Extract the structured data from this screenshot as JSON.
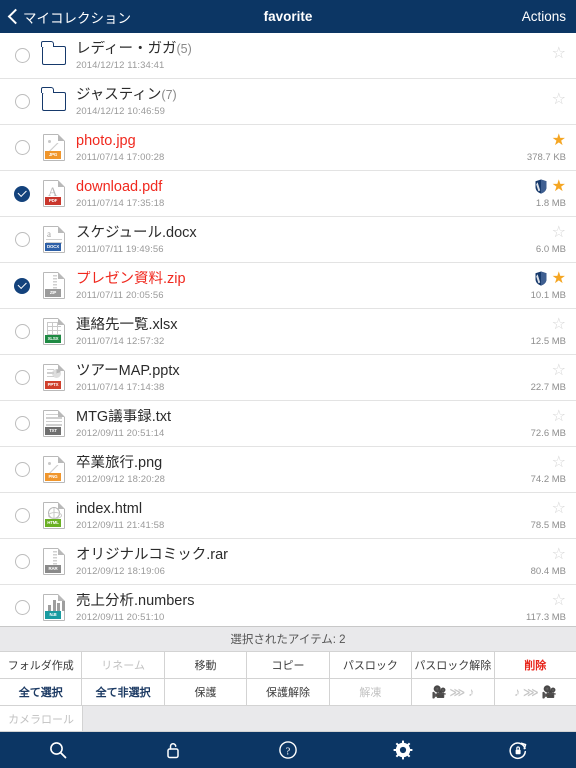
{
  "navbar": {
    "back_label": "マイコレクション",
    "title": "favorite",
    "actions_label": "Actions",
    "bg_color": "#0c3664"
  },
  "list": {
    "rows": [
      {
        "kind": "folder",
        "name": "レディー・ガガ",
        "count": "(5)",
        "date": "2014/12/12 11:34:41",
        "size": "",
        "checked": false,
        "starred": false,
        "locked": false,
        "name_red": false,
        "tag": ""
      },
      {
        "kind": "folder",
        "name": "ジャスティン",
        "count": "(7)",
        "date": "2014/12/12 10:46:59",
        "size": "",
        "checked": false,
        "starred": false,
        "locked": false,
        "name_red": false,
        "tag": ""
      },
      {
        "kind": "jpg",
        "name": "photo.jpg",
        "count": "",
        "date": "2011/07/14 17:00:28",
        "size": "378.7 KB",
        "checked": false,
        "starred": true,
        "locked": false,
        "name_red": true,
        "tag": "JPG"
      },
      {
        "kind": "pdf",
        "name": "download.pdf",
        "count": "",
        "date": "2011/07/14 17:35:18",
        "size": "1.8 MB",
        "checked": true,
        "starred": true,
        "locked": true,
        "name_red": true,
        "tag": "PDF"
      },
      {
        "kind": "docx",
        "name": "スケジュール.docx",
        "count": "",
        "date": "2011/07/11 19:49:56",
        "size": "6.0 MB",
        "checked": false,
        "starred": false,
        "locked": false,
        "name_red": false,
        "tag": "DOCX"
      },
      {
        "kind": "zip",
        "name": "プレゼン資料.zip",
        "count": "",
        "date": "2011/07/11 20:05:56",
        "size": "10.1 MB",
        "checked": true,
        "starred": true,
        "locked": true,
        "name_red": true,
        "tag": "ZIP"
      },
      {
        "kind": "xlsx",
        "name": "連絡先一覧.xlsx",
        "count": "",
        "date": "2011/07/14 12:57:32",
        "size": "12.5 MB",
        "checked": false,
        "starred": false,
        "locked": false,
        "name_red": false,
        "tag": "XLSX"
      },
      {
        "kind": "pptx",
        "name": "ツアーMAP.pptx",
        "count": "",
        "date": "2011/07/14 17:14:38",
        "size": "22.7 MB",
        "checked": false,
        "starred": false,
        "locked": false,
        "name_red": false,
        "tag": "PPTX"
      },
      {
        "kind": "txt",
        "name": "MTG議事録.txt",
        "count": "",
        "date": "2012/09/11 20:51:14",
        "size": "72.6 MB",
        "checked": false,
        "starred": false,
        "locked": false,
        "name_red": false,
        "tag": "TXT"
      },
      {
        "kind": "png",
        "name": "卒業旅行.png",
        "count": "",
        "date": "2012/09/12 18:20:28",
        "size": "74.2 MB",
        "checked": false,
        "starred": false,
        "locked": false,
        "name_red": false,
        "tag": "PNG"
      },
      {
        "kind": "html",
        "name": "index.html",
        "count": "",
        "date": "2012/09/11 21:41:58",
        "size": "78.5 MB",
        "checked": false,
        "starred": false,
        "locked": false,
        "name_red": false,
        "tag": "HTML"
      },
      {
        "kind": "rar",
        "name": "オリジナルコミック.rar",
        "count": "",
        "date": "2012/09/12 18:19:06",
        "size": "80.4 MB",
        "checked": false,
        "starred": false,
        "locked": false,
        "name_red": false,
        "tag": "RAR"
      },
      {
        "kind": "numbers",
        "name": "売上分析.numbers",
        "count": "",
        "date": "2012/09/11 20:51:10",
        "size": "117.3 MB",
        "checked": false,
        "starred": false,
        "locked": false,
        "name_red": false,
        "tag": "N.B"
      }
    ]
  },
  "panel": {
    "selected_text": "選択されたアイテム: 2",
    "row1": [
      {
        "label": "フォルダ作成",
        "state": "normal"
      },
      {
        "label": "リネーム",
        "state": "disabled"
      },
      {
        "label": "移動",
        "state": "normal"
      },
      {
        "label": "コピー",
        "state": "normal"
      },
      {
        "label": "パスロック",
        "state": "normal"
      },
      {
        "label": "パスロック解除",
        "state": "normal"
      },
      {
        "label": "削除",
        "state": "danger"
      }
    ],
    "row2": [
      {
        "label": "全て選択",
        "state": "bold"
      },
      {
        "label": "全て非選択",
        "state": "bold"
      },
      {
        "label": "保護",
        "state": "normal"
      },
      {
        "label": "保護解除",
        "state": "normal"
      },
      {
        "label": "解凍",
        "state": "disabled"
      },
      {
        "label": "",
        "state": "conv-video-to-audio"
      },
      {
        "label": "",
        "state": "conv-audio-to-video"
      }
    ],
    "row3": [
      {
        "label": "カメラロール",
        "state": "disabled"
      }
    ]
  },
  "tabbar": {
    "items": [
      {
        "icon": "search-icon"
      },
      {
        "icon": "lock-open-icon"
      },
      {
        "icon": "help-icon"
      },
      {
        "icon": "gear-icon"
      },
      {
        "icon": "lock-rotate-icon"
      }
    ]
  }
}
